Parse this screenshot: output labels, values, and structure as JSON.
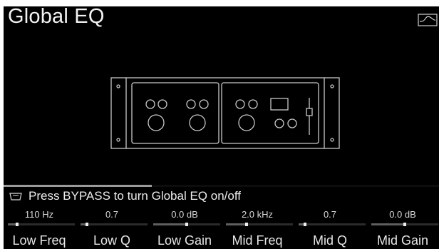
{
  "title": "Global EQ",
  "icons": {
    "bypass_indicator": "eq-curve-icon",
    "device": "rack-eq-unit-icon",
    "hint": "footswitch-icon"
  },
  "hint": {
    "text": "Press BYPASS to turn Global EQ on/off"
  },
  "params": [
    {
      "label": "Low Freq",
      "value": "110 Hz",
      "level": 0.12
    },
    {
      "label": "Low Q",
      "value": "0.7",
      "level": 0.08
    },
    {
      "label": "Low Gain",
      "value": "0.0 dB",
      "level": 0.5
    },
    {
      "label": "Mid Freq",
      "value": "2.0 kHz",
      "level": 0.3
    },
    {
      "label": "Mid Q",
      "value": "0.7",
      "level": 0.08
    },
    {
      "label": "Mid Gain",
      "value": "0.0 dB",
      "level": 0.5
    }
  ],
  "colors": {
    "background": "#000000",
    "text": "#ffffff",
    "accent": "#9a9a9a"
  }
}
